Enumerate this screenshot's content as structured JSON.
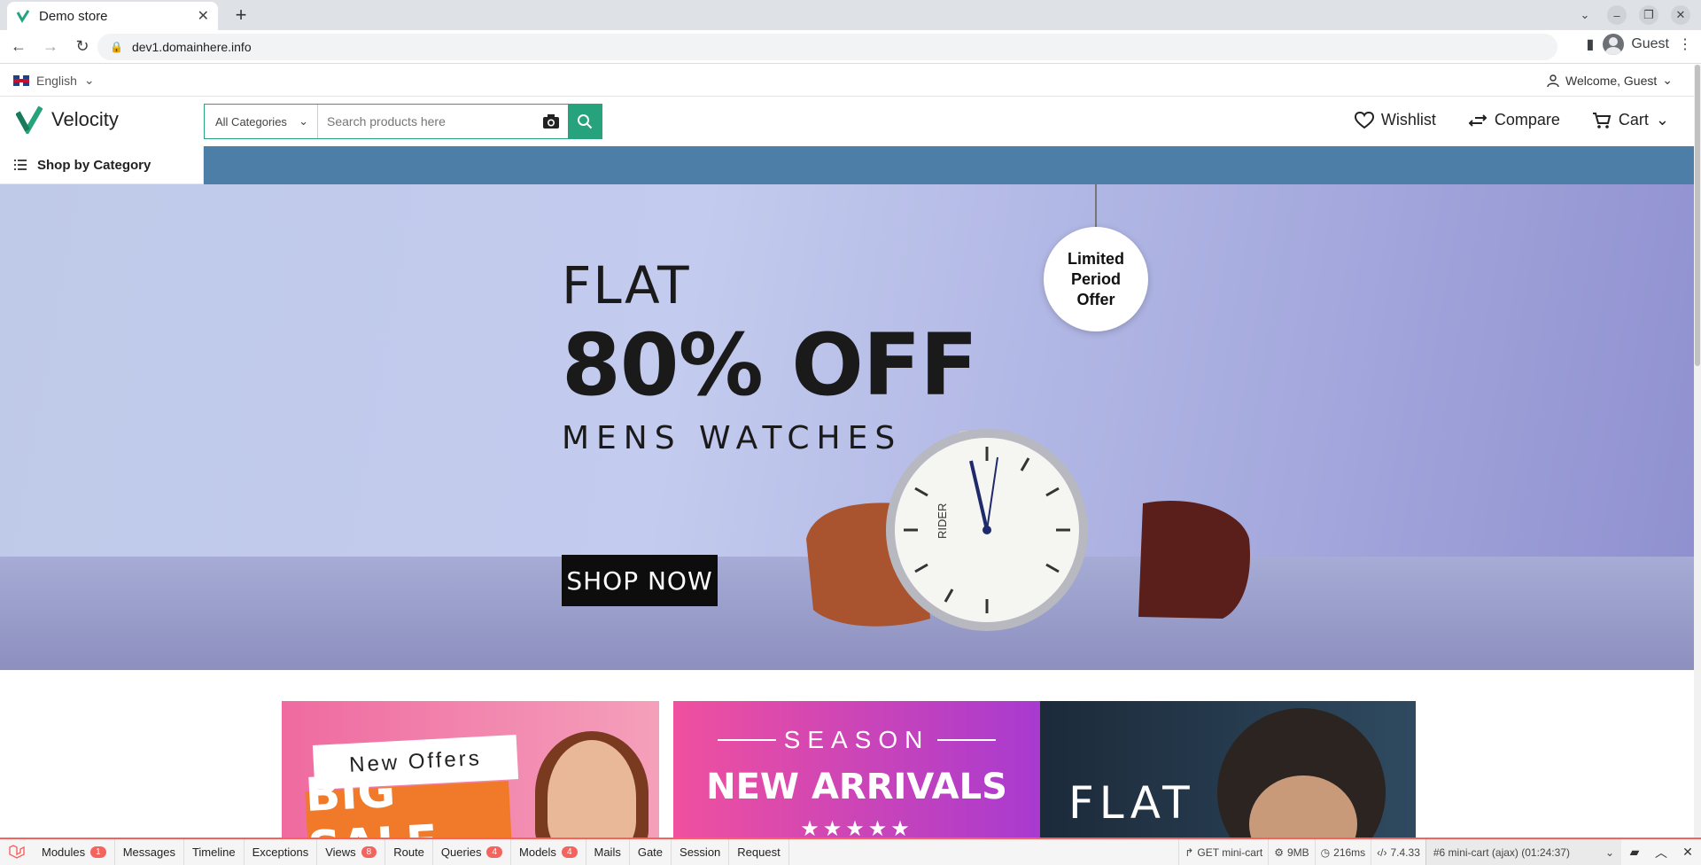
{
  "browser": {
    "tab_title": "Demo store",
    "url": "dev1.domainhere.info",
    "profile_label": "Guest"
  },
  "topbar": {
    "language": "English",
    "welcome": "Welcome, Guest"
  },
  "header": {
    "logo_text": "Velocity",
    "category_select": "All Categories",
    "search_placeholder": "Search products here",
    "wishlist": "Wishlist",
    "compare": "Compare",
    "cart": "Cart"
  },
  "nav": {
    "shop_by_category": "Shop by Category"
  },
  "hero": {
    "line1": "FLAT",
    "line2": "80% OFF",
    "line3": "MENS WATCHES",
    "cta": "SHOP NOW",
    "tag_l1": "Limited",
    "tag_l2": "Period",
    "tag_l3": "Offer",
    "watch_brand": "RIDER"
  },
  "banners": {
    "b1_top": "New Offers",
    "b1_main": "BIG SALE",
    "b2_top": "SEASON",
    "b2_main": "NEW ARRIVALS",
    "b2_stars": "★★★★★",
    "b3_main": "FLAT"
  },
  "debugbar": {
    "items": [
      {
        "label": "Modules",
        "badge": "1"
      },
      {
        "label": "Messages",
        "badge": ""
      },
      {
        "label": "Timeline",
        "badge": ""
      },
      {
        "label": "Exceptions",
        "badge": ""
      },
      {
        "label": "Views",
        "badge": "8"
      },
      {
        "label": "Route",
        "badge": ""
      },
      {
        "label": "Queries",
        "badge": "4"
      },
      {
        "label": "Models",
        "badge": "4"
      },
      {
        "label": "Mails",
        "badge": ""
      },
      {
        "label": "Gate",
        "badge": ""
      },
      {
        "label": "Session",
        "badge": ""
      },
      {
        "label": "Request",
        "badge": ""
      }
    ],
    "route": "GET mini-cart",
    "memory": "9MB",
    "time": "216ms",
    "php": "7.4.33",
    "request": "#6 mini-cart (ajax) (01:24:37)"
  },
  "colors": {
    "accent": "#26a37c",
    "catbar": "#4d7ea8",
    "debug_red": "#f4645f"
  }
}
